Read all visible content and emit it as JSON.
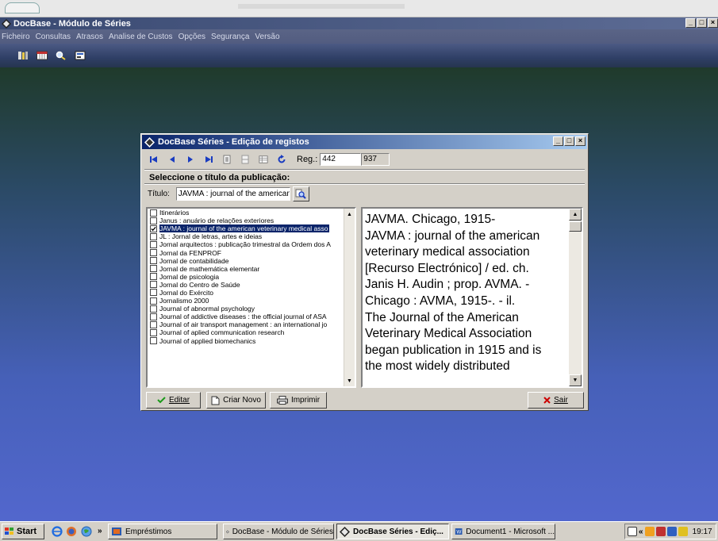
{
  "app": {
    "title": "DocBase - Módulo de Séries",
    "menu": [
      "Ficheiro",
      "Consultas",
      "Atrasos",
      "Analise de Custos",
      "Opções",
      "Segurança",
      "Versão"
    ],
    "toolbar_icons": [
      "series-icon",
      "calendar-icon",
      "search-icon",
      "report-icon"
    ]
  },
  "dialog": {
    "title": "DocBase Séries  - Edição de registos",
    "nav": {
      "icons": [
        "first-record-icon",
        "prev-record-icon",
        "next-record-icon",
        "last-record-icon",
        "list-icon",
        "columns-icon",
        "grid-icon",
        "refresh-icon"
      ],
      "reg_label": "Reg.:",
      "reg_value": "442",
      "reg_total": "937"
    },
    "prompt": "Seleccione o título da publicação:",
    "titulo_label": "Título:",
    "titulo_value": "JAVMA : journal of the american veterinary med",
    "list": [
      {
        "text": "Itinerários",
        "checked": false
      },
      {
        "text": "Janus : anuário de relações exteriores",
        "checked": false
      },
      {
        "text": "JAVMA : journal of the american veterinary medical asso",
        "checked": true,
        "selected": true
      },
      {
        "text": "JL : Jornal de letras, artes e ideias",
        "checked": false
      },
      {
        "text": "Jornal arquitectos : publicação trimestral da Ordem dos A",
        "checked": false
      },
      {
        "text": "Jornal da FENPROF",
        "checked": false
      },
      {
        "text": "Jornal de contabilidade",
        "checked": false
      },
      {
        "text": "Jornal de mathemática elementar",
        "checked": false
      },
      {
        "text": "Jornal de psicologia",
        "checked": false
      },
      {
        "text": "Jornal do Centro de Saúde",
        "checked": false
      },
      {
        "text": "Jornal do Exército",
        "checked": false
      },
      {
        "text": "Jornalismo 2000",
        "checked": false
      },
      {
        "text": "Journal of abnormal psychology",
        "checked": false
      },
      {
        "text": "Journal of addictive diseases : the official journal of ASA",
        "checked": false
      },
      {
        "text": "Journal of air transport management : an international jo",
        "checked": false
      },
      {
        "text": "Journal of aplied communication research",
        "checked": false
      },
      {
        "text": "Journal of applied biomechanics",
        "checked": false
      }
    ],
    "detail_lines": [
      "JAVMA. Chicago, 1915-",
      "JAVMA : journal of the american",
      "veterinary medical association",
      "[Recurso Electrónico] / ed. ch.",
      "Janis H. Audin ; prop. AVMA. -",
      "Chicago : AVMA, 1915-. - il.",
      "The Journal of the American",
      "Veterinary Medical Association",
      "began publication in 1915 and is",
      "the most widely distributed"
    ],
    "buttons": {
      "editar": "Editar",
      "criar_novo": "Criar Novo",
      "imprimir": "Imprimir",
      "sair": "Sair"
    }
  },
  "taskbar": {
    "start": "Start",
    "more": "»",
    "tasks": [
      {
        "label": "Empréstimos",
        "active": false
      },
      {
        "label": "DocBase - Módulo de Séries",
        "active": false
      },
      {
        "label": "DocBase Séries - Ediç...",
        "active": true
      },
      {
        "label": "Document1 - Microsoft ...",
        "active": false
      }
    ],
    "tray_more": "«",
    "clock": "19:17"
  },
  "colors": {
    "dialog_title_start": "#0a246a",
    "dialog_title_end": "#a6caf0",
    "selection": "#0a246a",
    "sair_icon": "#cc0000"
  }
}
